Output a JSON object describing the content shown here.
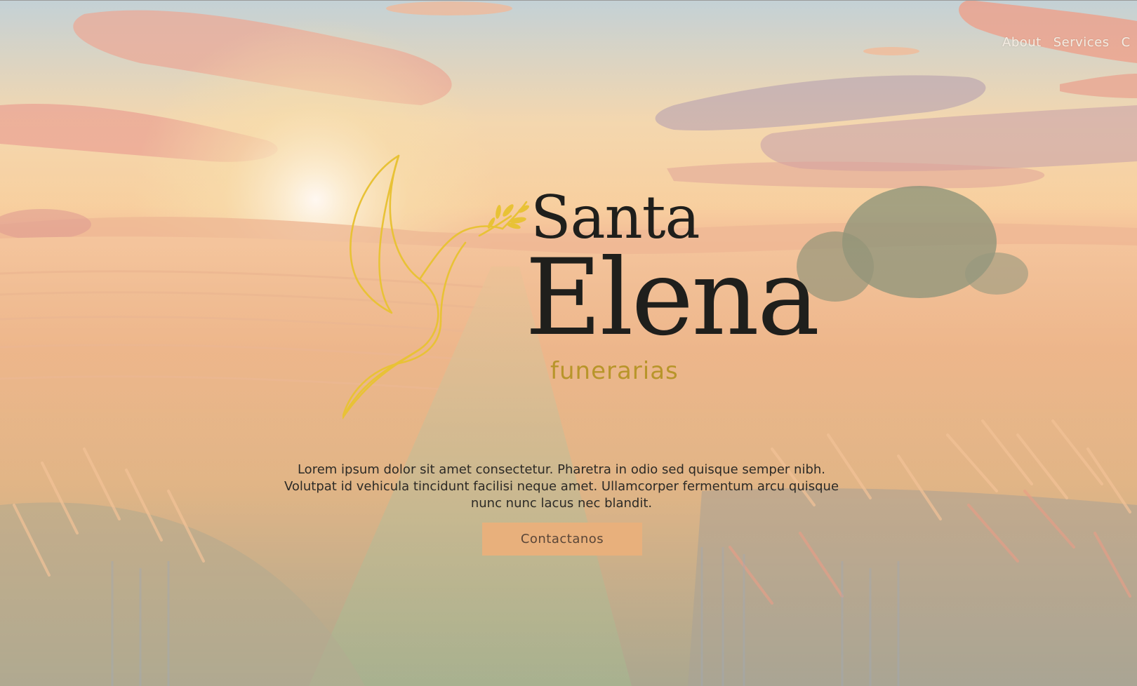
{
  "nav": {
    "items": [
      {
        "label": "About"
      },
      {
        "label": "Services"
      },
      {
        "label": "C"
      }
    ]
  },
  "brand": {
    "line1": "Santa",
    "line2": "Elena",
    "tagline": "funerarias"
  },
  "hero": {
    "description": "Lorem ipsum dolor sit amet consectetur. Pharetra in odio sed quisque semper nibh. Volutpat id vehicula tincidunt facilisi neque amet. Ullamcorper fermentum arcu quisque nunc nunc lacus nec blandit.",
    "cta_label": "Contactanos",
    "background_description": "sunset wheat field"
  },
  "colors": {
    "brand_dark": "#1f1f1c",
    "brand_gold": "#b8952a",
    "dove_gold": "#e8c236",
    "button_bg": "#e8b07c",
    "button_text": "#5a4638",
    "nav_text": "#f3ece2"
  },
  "icons": {
    "logo": "dove-with-branch-icon"
  }
}
